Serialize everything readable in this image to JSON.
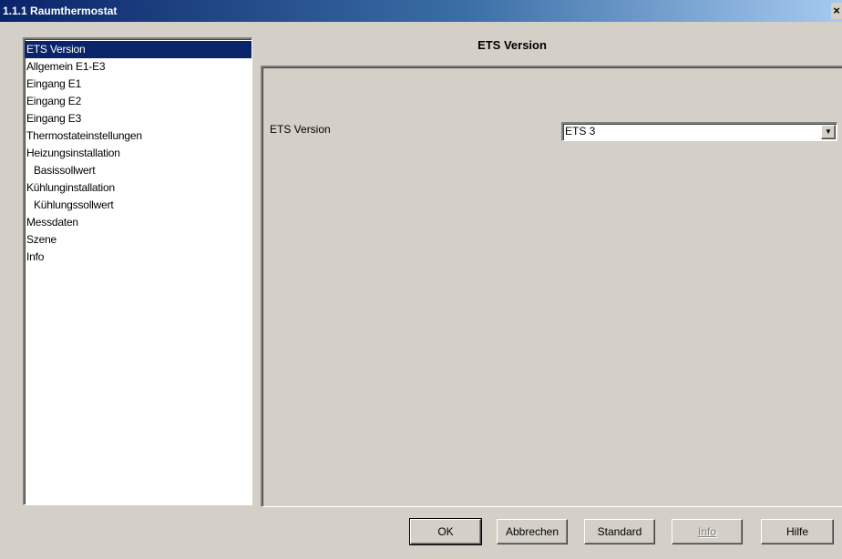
{
  "window": {
    "title": "1.1.1 Raumthermostat",
    "close_label": "×"
  },
  "nav": {
    "items": [
      {
        "label": "ETS Version",
        "selected": true,
        "sub": false
      },
      {
        "label": "Allgemein E1-E3",
        "selected": false,
        "sub": false
      },
      {
        "label": "Eingang E1",
        "selected": false,
        "sub": false
      },
      {
        "label": "Eingang E2",
        "selected": false,
        "sub": false
      },
      {
        "label": "Eingang E3",
        "selected": false,
        "sub": false
      },
      {
        "label": "Thermostateinstellungen",
        "selected": false,
        "sub": false
      },
      {
        "label": "Heizungsinstallation",
        "selected": false,
        "sub": false
      },
      {
        "label": "Basissollwert",
        "selected": false,
        "sub": true
      },
      {
        "label": "Kühlunginstallation",
        "selected": false,
        "sub": false
      },
      {
        "label": "Kühlungssollwert",
        "selected": false,
        "sub": true
      },
      {
        "label": "Messdaten",
        "selected": false,
        "sub": false
      },
      {
        "label": "Szene",
        "selected": false,
        "sub": false
      },
      {
        "label": "Info",
        "selected": false,
        "sub": false
      }
    ]
  },
  "main": {
    "title": "ETS Version",
    "param_label": "ETS Version",
    "param_value": "ETS 3",
    "dropdown_icon": "chevron-down-icon"
  },
  "buttons": {
    "ok": "OK",
    "cancel": "Abbrechen",
    "standard": "Standard",
    "info": "Info",
    "help": "Hilfe"
  },
  "colors": {
    "selection": "#0a246a",
    "dialog_bg": "#d4d0c8",
    "titlebar_start": "#0a246a",
    "titlebar_end": "#a6caf0"
  }
}
